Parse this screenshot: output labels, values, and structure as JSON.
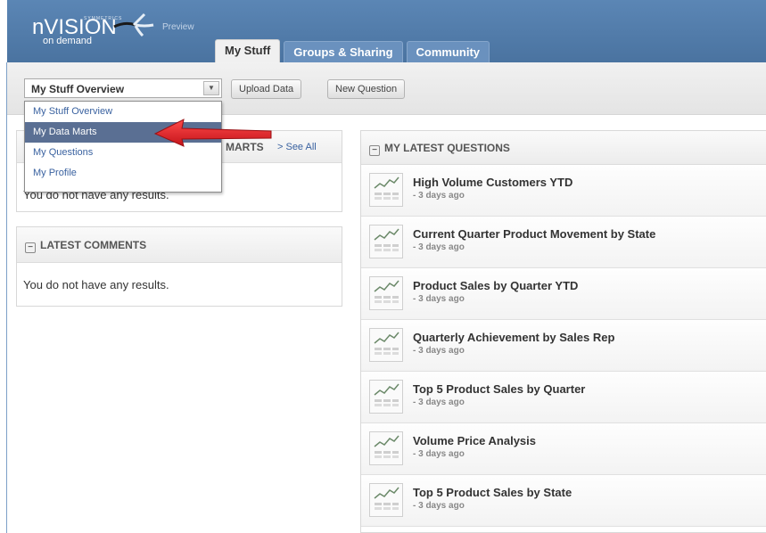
{
  "header": {
    "brand_small": "SYMMETRICS",
    "brand_name": "nVISION",
    "brand_sub": "on demand",
    "preview_label": "Preview",
    "tabs": [
      {
        "label": "My Stuff"
      },
      {
        "label": "Groups & Sharing"
      },
      {
        "label": "Community"
      }
    ]
  },
  "toolbar": {
    "dropdown_value": "My Stuff Overview",
    "upload_label": "Upload Data",
    "new_question_label": "New Question"
  },
  "dropdown_menu": {
    "items": [
      {
        "label": "My Stuff Overview"
      },
      {
        "label": "My Data Marts"
      },
      {
        "label": "My Questions"
      },
      {
        "label": "My Profile"
      }
    ],
    "selected_index": 1
  },
  "data_marts_panel": {
    "title_fragment": "MARTS",
    "see_all": "> See All",
    "empty_partial": "You do not have any results."
  },
  "comments_panel": {
    "title": "LATEST COMMENTS",
    "empty": "You do not have any results."
  },
  "questions_panel": {
    "title": "MY LATEST QUESTIONS",
    "items": [
      {
        "title": "High Volume Customers YTD",
        "time": "- 3 days ago"
      },
      {
        "title": "Current Quarter Product Movement by State",
        "time": "- 3 days ago"
      },
      {
        "title": "Product Sales by Quarter YTD",
        "time": "- 3 days ago"
      },
      {
        "title": "Quarterly Achievement by Sales Rep",
        "time": "- 3 days ago"
      },
      {
        "title": "Top 5 Product Sales by Quarter",
        "time": "- 3 days ago"
      },
      {
        "title": "Volume Price Analysis",
        "time": "- 3 days ago"
      },
      {
        "title": "Top 5 Product Sales by State",
        "time": "- 3 days ago"
      }
    ]
  },
  "colors": {
    "header_blue": "#4a73a0",
    "link_blue": "#3a62a0",
    "selected_menu": "#5a6f93",
    "annotation_arrow": "#e8242a"
  }
}
